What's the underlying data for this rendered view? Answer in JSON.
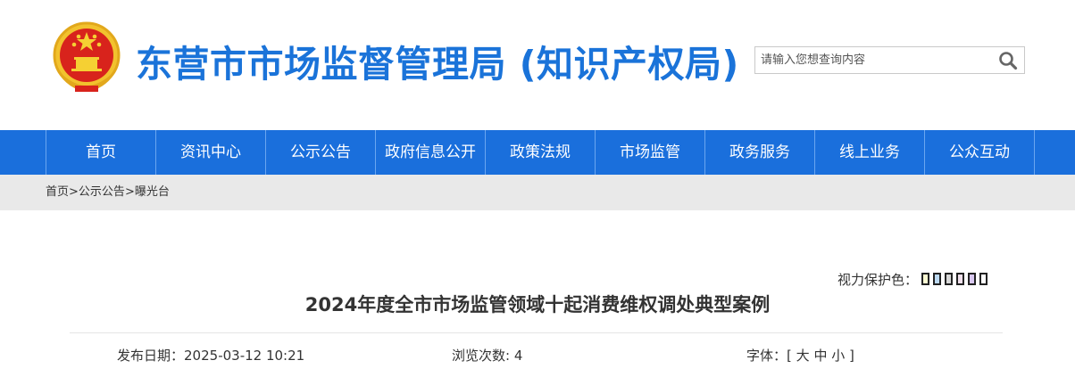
{
  "header": {
    "site_title": "东营市市场监督管理局 (知识产权局)",
    "search_placeholder": "请输入您想查询内容"
  },
  "nav": {
    "items": [
      "首页",
      "资讯中心",
      "公示公告",
      "政府信息公开",
      "政策法规",
      "市场监管",
      "政务服务",
      "线上业务",
      "公众互动"
    ]
  },
  "breadcrumb": {
    "home": "首页",
    "sep": ">",
    "level1": "公示公告",
    "level2": "曝光台"
  },
  "article": {
    "eye_protect_label": "视力保护色：",
    "swatches": [
      "#fafad2",
      "#dcebf7",
      "#e6e6e6",
      "#f0e6f0",
      "#e6d8f5",
      "#ffffff"
    ],
    "title": "2024年度全市市场监管领域十起消费维权调处典型案例",
    "publish_label": "发布日期：",
    "publish_date": "2025-03-12 10:21",
    "views_label": "浏览次数:",
    "views": "4",
    "font_label": "字体：[",
    "font_large": "大",
    "font_medium": "中",
    "font_small": "小",
    "font_close": "]"
  },
  "colors": {
    "brand_blue": "#1a73d9",
    "nav_blue": "#1a6fdc"
  }
}
